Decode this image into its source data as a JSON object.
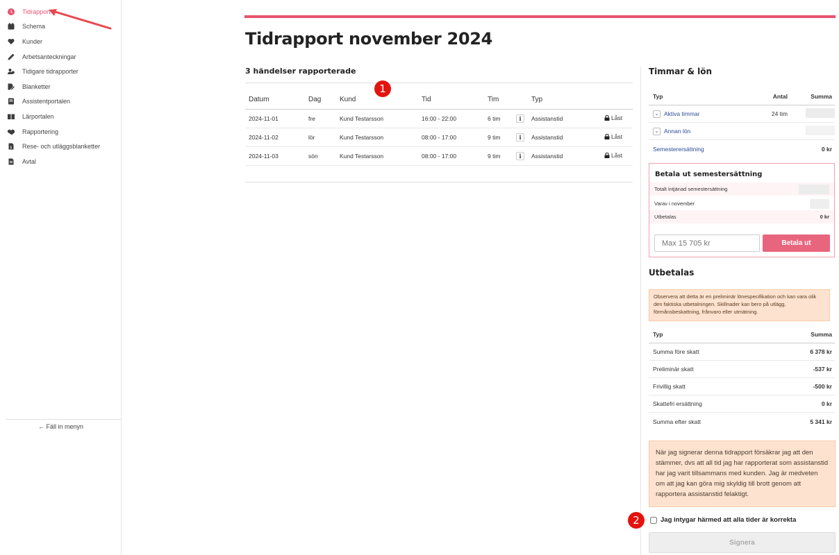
{
  "sidebar": {
    "items": [
      {
        "label": "Tidrapport",
        "icon": "clock-icon",
        "active": true
      },
      {
        "label": "Schema",
        "icon": "calendar-icon"
      },
      {
        "label": "Kunder",
        "icon": "heart-icon"
      },
      {
        "label": "Arbetsanteckningar",
        "icon": "pencil-icon"
      },
      {
        "label": "Tidigare tidrapporter",
        "icon": "users-icon"
      },
      {
        "label": "Blanketter",
        "icon": "file-edit-icon"
      },
      {
        "label": "Assistentportalen",
        "icon": "book-icon"
      },
      {
        "label": "Lärportalen",
        "icon": "open-book-icon"
      },
      {
        "label": "Rapportering",
        "icon": "handshake-icon"
      },
      {
        "label": "Rese- och utläggsblanketter",
        "icon": "receipt-icon"
      },
      {
        "label": "Avtal",
        "icon": "document-icon"
      }
    ],
    "collapse_label": "← Fäll in menyn"
  },
  "page": {
    "title": "Tidrapport november 2024"
  },
  "events": {
    "title": "3 händelser rapporterade",
    "columns": [
      "Datum",
      "Dag",
      "Kund",
      "Tid",
      "Tim",
      "",
      "Typ",
      ""
    ],
    "rows": [
      {
        "date": "2024-11-01",
        "day": "fre",
        "customer": "Kund Testarsson",
        "time": "16:00 - 22:00",
        "hours": "6 tim",
        "type": "Assistanstid",
        "status": "Låst"
      },
      {
        "date": "2024-11-02",
        "day": "lör",
        "customer": "Kund Testarsson",
        "time": "08:00 - 17:00",
        "hours": "9 tim",
        "type": "Assistanstid",
        "status": "Låst"
      },
      {
        "date": "2024-11-03",
        "day": "sön",
        "customer": "Kund Testarsson",
        "time": "08:00 - 17:00",
        "hours": "9 tim",
        "type": "Assistanstid",
        "status": "Låst"
      }
    ]
  },
  "annotations": {
    "badge1": "1",
    "badge2": "2",
    "arrow_color": "#e8484f"
  },
  "hours_pay": {
    "title": "Timmar & lön",
    "head": {
      "type": "Typ",
      "count": "Antal",
      "sum": "Summa"
    },
    "rows": [
      {
        "label": "Aktiva timmar",
        "count": "24 tim"
      },
      {
        "label": "Annan lön",
        "count": ""
      }
    ],
    "vacation": {
      "label": "Semesterersättning",
      "sum": "0 kr"
    }
  },
  "payout": {
    "title": "Betala ut semestersättning",
    "total_label": "Totalt intjänad semestersättning",
    "month_label": "Varav i november",
    "paid_label": "Utbetalas",
    "paid_value": "0 kr",
    "input_placeholder": "Max 15 705 kr",
    "button_label": "Betala ut"
  },
  "utbetalas": {
    "title": "Utbetalas",
    "notice": "Observera att detta är en preliminär lönespecifikation och kan vara olik den faktiska utbetalningen. Skillnader kan bero på utlägg, förmånsbeskattning, frånvaro eller utmätning.",
    "head": {
      "type": "Typ",
      "sum": "Summa"
    },
    "rows": [
      {
        "label": "Summa före skatt",
        "value": "6 378 kr"
      },
      {
        "label": "Preliminär skatt",
        "value": "-537 kr"
      },
      {
        "label": "Frivillig skatt",
        "value": "-500 kr"
      },
      {
        "label": "Skattefri ersättning",
        "value": "0 kr"
      },
      {
        "label": "Summa efter skatt",
        "value": "5 341 kr"
      }
    ]
  },
  "certification": {
    "text": "När jag signerar denna tidrapport försäkrar jag att den stämmer, dvs att all tid jag har rapporterat som assistanstid har jag varit tillsammans med kunden. Jag är medveten om att jag kan göra mig skyldig till brott genom att rapportera assistanstid felaktigt.",
    "checkbox_label": "Jag intygar härmed att alla tider är korrekta",
    "sign_label": "Signera"
  },
  "colors": {
    "accent": "#e8536e",
    "link": "#2d4a9a",
    "notice_bg": "#fde3cf"
  }
}
